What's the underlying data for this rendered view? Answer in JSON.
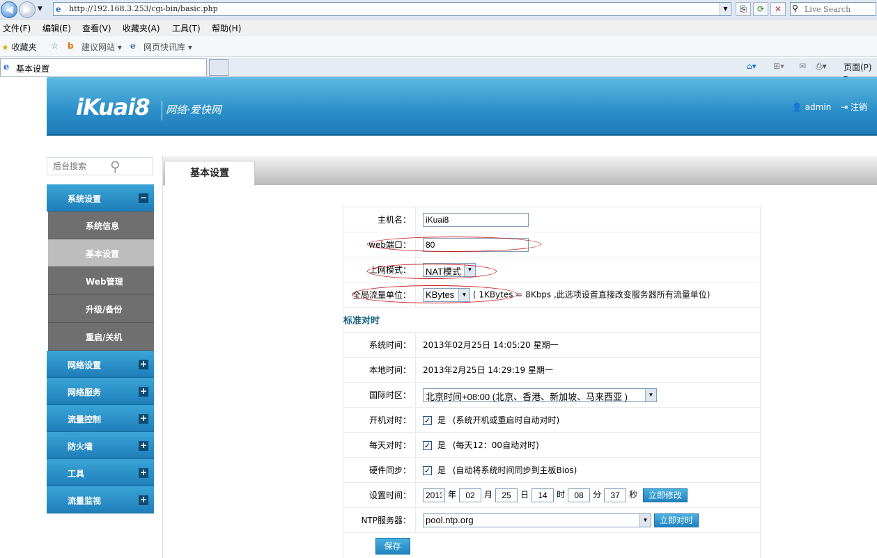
{
  "browser": {
    "url": "http://192.168.3.253/cgi-bin/basic.php",
    "search_placeholder": "Live Search",
    "menu": [
      "文件(F)",
      "编辑(E)",
      "查看(V)",
      "收藏夹(A)",
      "工具(T)",
      "帮助(H)"
    ],
    "favorites_label": "收藏夹",
    "fav_links": [
      "建议网站 ▾",
      "网页快讯库 ▾"
    ],
    "tab_title": "基本设置",
    "page_menu": "页面(P) ▾"
  },
  "header": {
    "logo": "iKuai8",
    "tagline": "网络·爱快网",
    "user": "admin",
    "logout": "注销"
  },
  "sidebar": {
    "search_placeholder": "后台搜索",
    "groups": [
      {
        "label": "系统设置",
        "expanded": true,
        "toggle": "−"
      },
      {
        "label": "网络设置",
        "toggle": "+"
      },
      {
        "label": "网络服务",
        "toggle": "+"
      },
      {
        "label": "流量控制",
        "toggle": "+"
      },
      {
        "label": "防火墙",
        "toggle": "+"
      },
      {
        "label": "工具",
        "toggle": "+"
      },
      {
        "label": "流量监视",
        "toggle": "+"
      }
    ],
    "sub_items": [
      "系统信息",
      "基本设置",
      "Web管理",
      "升级/备份",
      "重启/关机"
    ],
    "active_sub": "基本设置"
  },
  "content": {
    "tab": "基本设置",
    "fields": {
      "hostname_label": "主机名：",
      "hostname": "iKuai8",
      "web_port_label": "web端口：",
      "web_port": "80",
      "mode_label": "上网模式：",
      "mode": "NAT模式",
      "unit_label": "全局流量单位：",
      "unit": "KBytes",
      "unit_hint": "( 1KBytes = 8Kbps ,此选项设置直接改变服务器所有流量单位)"
    },
    "time_section": "标准对时",
    "time": {
      "sys_label": "系统时间：",
      "sys_value": "2013年02月25日 14:05:20  星期一",
      "local_label": "本地时间：",
      "local_value": "2013年2月25日 14:29:19  星期一",
      "tz_label": "国际时区：",
      "tz_value": "北京时间+08:00 (北京、香港、新加坡、马来西亚 )",
      "boot_label": "开机对时：",
      "boot_yes": "是",
      "boot_hint": "(系统开机或重启时自动对时)",
      "daily_label": "每天对时：",
      "daily_yes": "是",
      "daily_hint": "(每天12：00自动对时)",
      "hw_label": "硬件同步：",
      "hw_yes": "是",
      "hw_hint": "(自动将系统时间同步到主板Bios)",
      "set_label": "设置时间：",
      "year": "2013",
      "year_u": "年",
      "month": "02",
      "month_u": "月",
      "day": "25",
      "day_u": "日",
      "hour": "14",
      "hour_u": "时",
      "minute": "08",
      "minute_u": "分",
      "second": "37",
      "second_u": "秒",
      "modify_btn": "立即修改",
      "ntp_label": "NTP服务器：",
      "ntp_value": "pool.ntp.org",
      "sync_btn": "立即对时"
    },
    "save_btn": "保存"
  }
}
